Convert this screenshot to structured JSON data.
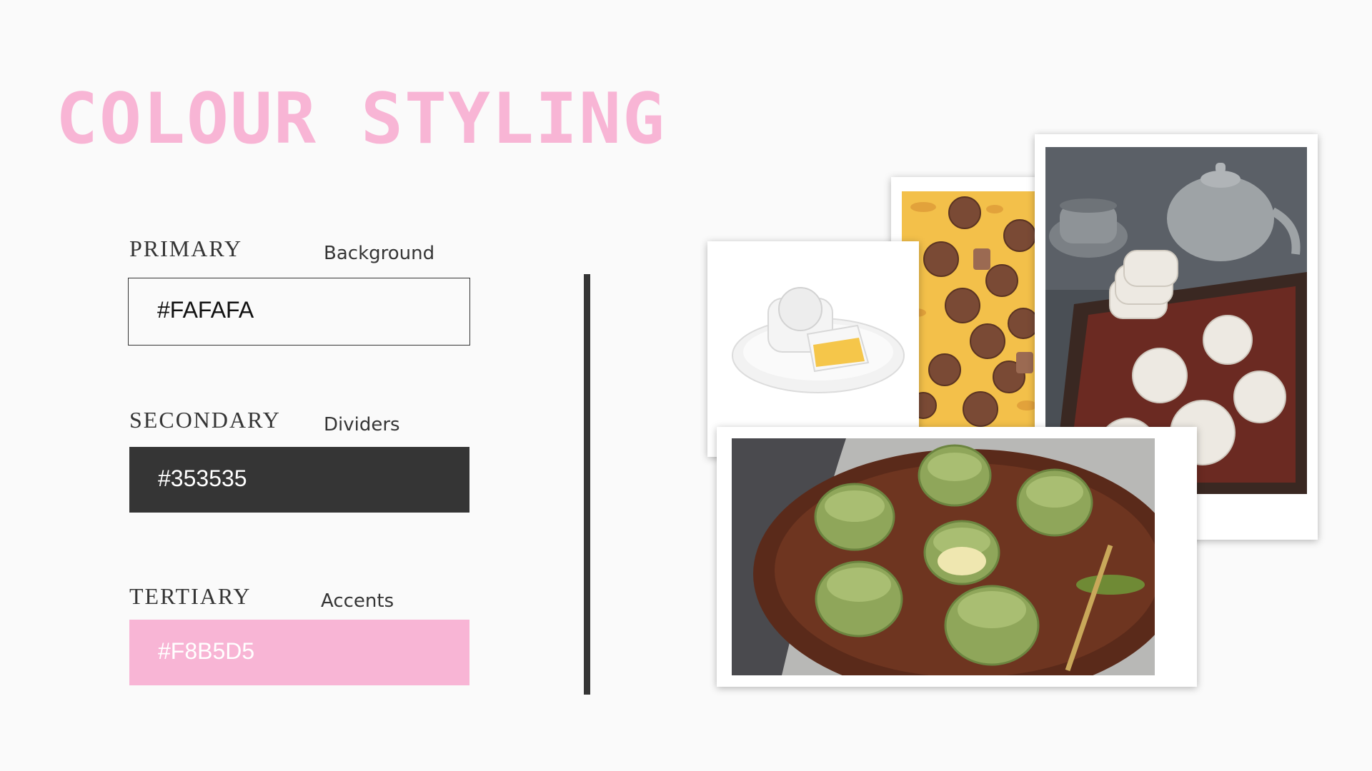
{
  "title": "COLOUR STYLING",
  "palette": [
    {
      "label": "PRIMARY",
      "role": "Background",
      "hex": "#FAFAFA"
    },
    {
      "label": "SECONDARY",
      "role": "Dividers",
      "hex": "#353535"
    },
    {
      "label": "TERTIARY",
      "role": "Accents",
      "hex": "#F8B5D5"
    }
  ],
  "colors": {
    "background": "#FAFAFA",
    "divider": "#353535",
    "accent": "#F8B5D5"
  },
  "photos": [
    "snow-skin-mooncake-on-plate",
    "chocolate-mooncakes-on-yellow",
    "white-mooncakes-with-teapot",
    "matcha-mooncakes-on-wooden-tray"
  ]
}
